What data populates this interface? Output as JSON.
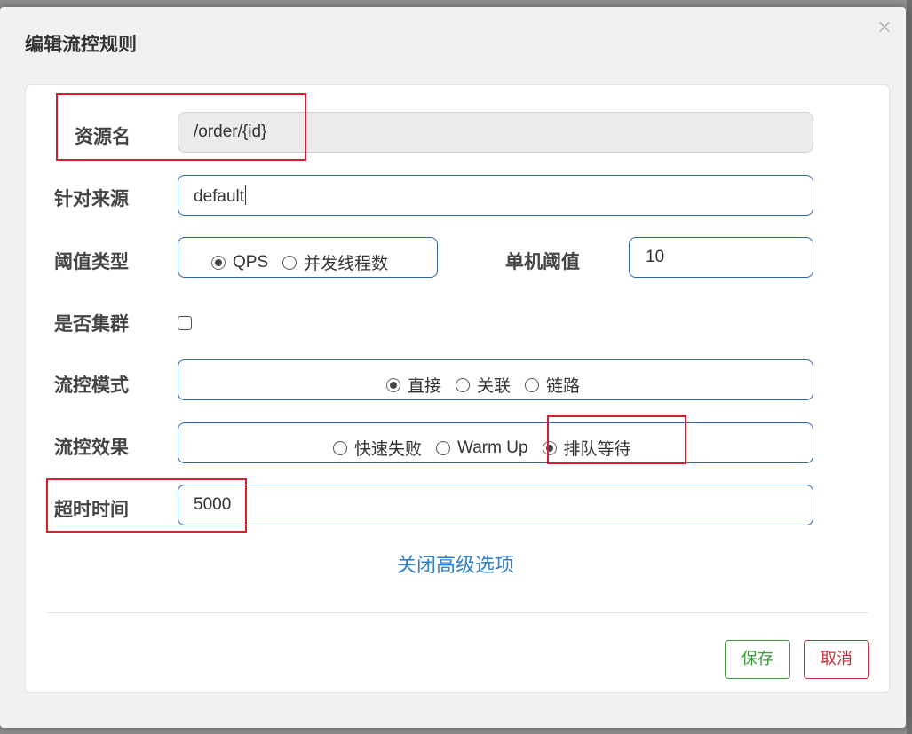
{
  "dialog": {
    "title": "编辑流控规则",
    "close_glyph": "×"
  },
  "form": {
    "resource": {
      "label": "资源名",
      "value": "/order/{id}"
    },
    "source": {
      "label": "针对来源",
      "value": "default"
    },
    "threshold_type": {
      "label": "阈值类型",
      "options": [
        "QPS",
        "并发线程数"
      ],
      "selected": "QPS"
    },
    "threshold": {
      "label": "单机阈值",
      "value": "10"
    },
    "cluster": {
      "label": "是否集群",
      "checked": false
    },
    "flow_mode": {
      "label": "流控模式",
      "options": [
        "直接",
        "关联",
        "链路"
      ],
      "selected": "直接"
    },
    "flow_effect": {
      "label": "流控效果",
      "options": [
        "快速失败",
        "Warm Up",
        "排队等待"
      ],
      "selected": "排队等待"
    },
    "timeout": {
      "label": "超时时间",
      "value": "5000"
    },
    "advanced_toggle": "关闭高级选项"
  },
  "footer": {
    "save_label": "保存",
    "cancel_label": "取消"
  },
  "colors": {
    "primary_border": "#2f66a6",
    "link": "#2f82c6",
    "save": "#3a9a3a",
    "cancel": "#c9303a",
    "annotation": "#d3202a"
  }
}
